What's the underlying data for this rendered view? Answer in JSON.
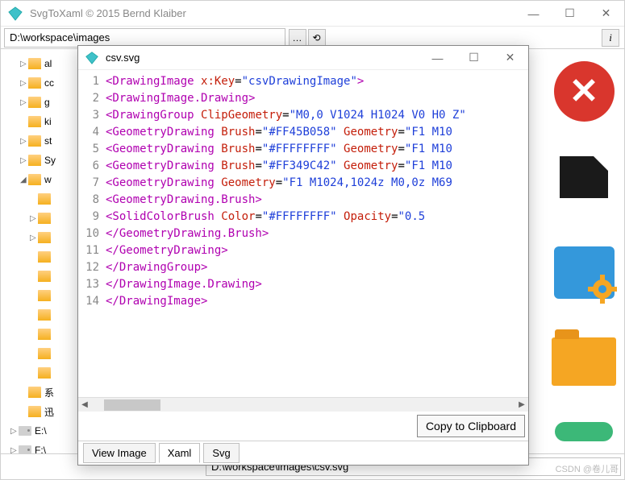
{
  "main": {
    "title": "SvgToXaml   © 2015 Bernd Klaiber",
    "path": "D:\\workspace\\images",
    "bottom_path": "D:\\workspace\\images\\csv.svg",
    "watermark": "CSDN @卷儿哥"
  },
  "tree": {
    "items": [
      {
        "exp": "▷",
        "label": "al",
        "lvl": 1,
        "type": "folder"
      },
      {
        "exp": "▷",
        "label": "cc",
        "lvl": 1,
        "type": "folder"
      },
      {
        "exp": "▷",
        "label": "g",
        "lvl": 1,
        "type": "folder"
      },
      {
        "exp": "",
        "label": "ki",
        "lvl": 1,
        "type": "folder"
      },
      {
        "exp": "▷",
        "label": "st",
        "lvl": 1,
        "type": "folder"
      },
      {
        "exp": "▷",
        "label": "Sy",
        "lvl": 1,
        "type": "folder"
      },
      {
        "exp": "◢",
        "label": "w",
        "lvl": 1,
        "type": "folder"
      },
      {
        "exp": "",
        "label": "",
        "lvl": 2,
        "type": "folder"
      },
      {
        "exp": "▷",
        "label": "",
        "lvl": 2,
        "type": "folder"
      },
      {
        "exp": "▷",
        "label": "",
        "lvl": 2,
        "type": "folder"
      },
      {
        "exp": "",
        "label": "",
        "lvl": 2,
        "type": "folder"
      },
      {
        "exp": "",
        "label": "",
        "lvl": 2,
        "type": "folder"
      },
      {
        "exp": "",
        "label": "",
        "lvl": 2,
        "type": "folder"
      },
      {
        "exp": "",
        "label": "",
        "lvl": 2,
        "type": "folder"
      },
      {
        "exp": "",
        "label": "",
        "lvl": 2,
        "type": "folder"
      },
      {
        "exp": "",
        "label": "",
        "lvl": 2,
        "type": "folder"
      },
      {
        "exp": "",
        "label": "",
        "lvl": 2,
        "type": "folder"
      },
      {
        "exp": "",
        "label": "系",
        "lvl": 1,
        "type": "folder"
      },
      {
        "exp": "",
        "label": "迅",
        "lvl": 1,
        "type": "folder"
      },
      {
        "exp": "▷",
        "label": "E:\\",
        "lvl": 0,
        "type": "drive"
      },
      {
        "exp": "▷",
        "label": "F:\\",
        "lvl": 0,
        "type": "drive"
      }
    ]
  },
  "sub": {
    "title": "csv.svg",
    "copy_label": "Copy to Clipboard",
    "tabs": [
      "View Image",
      "Xaml",
      "Svg"
    ],
    "active_tab": 1,
    "code_lines": [
      [
        {
          "t": "tag",
          "v": "<DrawingImage "
        },
        {
          "t": "attr",
          "v": "x:Key"
        },
        {
          "t": "txt",
          "v": "="
        },
        {
          "t": "val",
          "v": "\"csvDrawingImage\""
        },
        {
          "t": "tag",
          "v": ">"
        }
      ],
      [
        {
          "t": "txt",
          "v": "  "
        },
        {
          "t": "tag",
          "v": "<DrawingImage.Drawing>"
        }
      ],
      [
        {
          "t": "txt",
          "v": "    "
        },
        {
          "t": "tag",
          "v": "<DrawingGroup "
        },
        {
          "t": "attr",
          "v": "ClipGeometry"
        },
        {
          "t": "txt",
          "v": "="
        },
        {
          "t": "val",
          "v": "\"M0,0 V1024 H1024 V0 H0 Z\""
        }
      ],
      [
        {
          "t": "txt",
          "v": "      "
        },
        {
          "t": "tag",
          "v": "<GeometryDrawing "
        },
        {
          "t": "attr",
          "v": "Brush"
        },
        {
          "t": "txt",
          "v": "="
        },
        {
          "t": "val",
          "v": "\"#FF45B058\" "
        },
        {
          "t": "attr",
          "v": "Geometry"
        },
        {
          "t": "txt",
          "v": "="
        },
        {
          "t": "val",
          "v": "\"F1 M10"
        }
      ],
      [
        {
          "t": "txt",
          "v": "      "
        },
        {
          "t": "tag",
          "v": "<GeometryDrawing "
        },
        {
          "t": "attr",
          "v": "Brush"
        },
        {
          "t": "txt",
          "v": "="
        },
        {
          "t": "val",
          "v": "\"#FFFFFFFF\" "
        },
        {
          "t": "attr",
          "v": "Geometry"
        },
        {
          "t": "txt",
          "v": "="
        },
        {
          "t": "val",
          "v": "\"F1 M10"
        }
      ],
      [
        {
          "t": "txt",
          "v": "      "
        },
        {
          "t": "tag",
          "v": "<GeometryDrawing "
        },
        {
          "t": "attr",
          "v": "Brush"
        },
        {
          "t": "txt",
          "v": "="
        },
        {
          "t": "val",
          "v": "\"#FF349C42\" "
        },
        {
          "t": "attr",
          "v": "Geometry"
        },
        {
          "t": "txt",
          "v": "="
        },
        {
          "t": "val",
          "v": "\"F1 M10"
        }
      ],
      [
        {
          "t": "txt",
          "v": "      "
        },
        {
          "t": "tag",
          "v": "<GeometryDrawing "
        },
        {
          "t": "attr",
          "v": "Geometry"
        },
        {
          "t": "txt",
          "v": "="
        },
        {
          "t": "val",
          "v": "\"F1 M1024,1024z M0,0z M69"
        }
      ],
      [
        {
          "t": "txt",
          "v": "        "
        },
        {
          "t": "tag",
          "v": "<GeometryDrawing.Brush>"
        }
      ],
      [
        {
          "t": "txt",
          "v": "          "
        },
        {
          "t": "tag",
          "v": "<SolidColorBrush "
        },
        {
          "t": "attr",
          "v": "Color"
        },
        {
          "t": "txt",
          "v": "="
        },
        {
          "t": "val",
          "v": "\"#FFFFFFFF\" "
        },
        {
          "t": "attr",
          "v": "Opacity"
        },
        {
          "t": "txt",
          "v": "="
        },
        {
          "t": "val",
          "v": "\"0.5"
        }
      ],
      [
        {
          "t": "txt",
          "v": "        "
        },
        {
          "t": "tag",
          "v": "</GeometryDrawing.Brush>"
        }
      ],
      [
        {
          "t": "txt",
          "v": "      "
        },
        {
          "t": "tag",
          "v": "</GeometryDrawing>"
        }
      ],
      [
        {
          "t": "txt",
          "v": "    "
        },
        {
          "t": "tag",
          "v": "</DrawingGroup>"
        }
      ],
      [
        {
          "t": "txt",
          "v": "  "
        },
        {
          "t": "tag",
          "v": "</DrawingImage.Drawing>"
        }
      ],
      [
        {
          "t": "tag",
          "v": "</DrawingImage>"
        }
      ]
    ]
  }
}
